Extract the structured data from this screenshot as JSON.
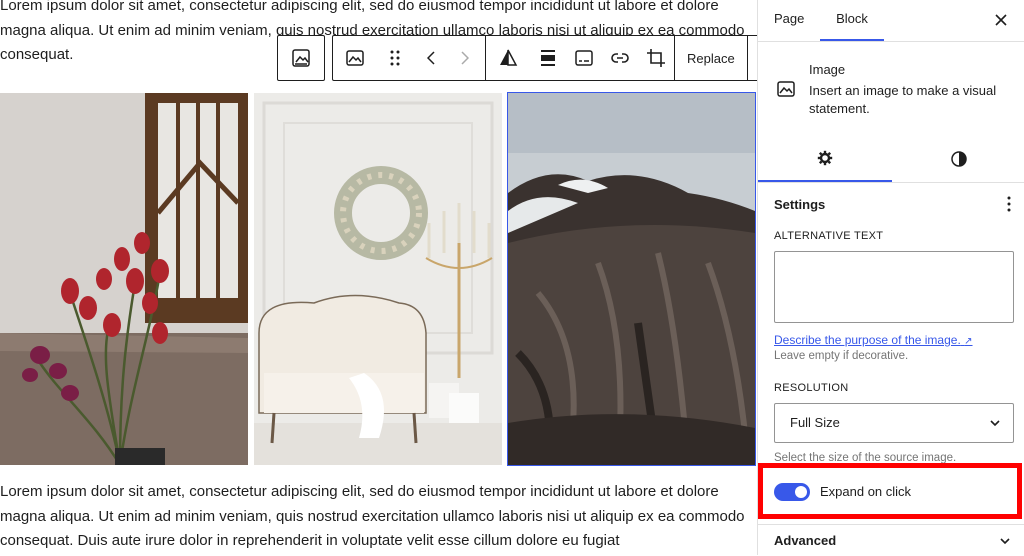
{
  "content": {
    "paragraph_top": "Lorem ipsum dolor sit amet, consectetur adipiscing elit, sed do eiusmod tempor incididunt ut labore et dolore magna aliqua. Ut enim ad minim veniam, quis nostrud exercitation ullamco laboris nisi ut aliquip ex ea commodo consequat.",
    "paragraph_bottom": "Lorem ipsum dolor sit amet, consectetur adipiscing elit, sed do eiusmod tempor incididunt ut labore et dolore magna aliqua. Ut enim ad minim veniam, quis nostrud exercitation ullamco laboris nisi ut aliquip ex ea commodo consequat. Duis aute irure dolor in reprehenderit in voluptate velit esse cillum dolore eu fugiat"
  },
  "toolbar": {
    "replace_label": "Replace",
    "icons": [
      "gallery-icon",
      "image-icon",
      "drag-handle-icon",
      "chevron-left-icon",
      "chevron-right-icon",
      "duotone-icon",
      "align-icon",
      "caption-icon",
      "link-icon",
      "crop-icon",
      "more-options-icon"
    ]
  },
  "gallery": {
    "images": [
      "tulips-by-window",
      "wreath-and-sofa",
      "mountain-ridge"
    ],
    "selected_index": 2
  },
  "sidebar": {
    "tabs": [
      "Page",
      "Block"
    ],
    "active_tab": "Block",
    "block": {
      "title": "Image",
      "description": "Insert an image to make a visual statement."
    },
    "settings": {
      "heading": "Settings",
      "alt_text_label": "ALTERNATIVE TEXT",
      "alt_text_value": "",
      "alt_link": "Describe the purpose of the image.",
      "alt_help": "Leave empty if decorative.",
      "resolution_label": "RESOLUTION",
      "resolution_value": "Full Size",
      "resolution_help": "Select the size of the source image.",
      "expand_label": "Expand on click",
      "expand_on": true
    },
    "advanced_label": "Advanced"
  },
  "colors": {
    "accent": "#3858e9",
    "highlight": "#ff0000",
    "text": "#1e1e1e",
    "muted": "#757575"
  }
}
